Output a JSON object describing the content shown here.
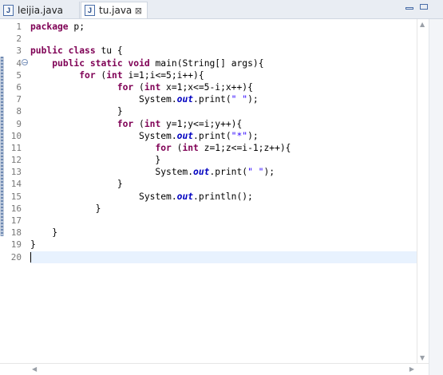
{
  "tabs": [
    {
      "label": "leijia.java",
      "icon": "J",
      "active": false
    },
    {
      "label": "tu.java",
      "icon": "J",
      "active": true,
      "close": "⊠"
    }
  ],
  "window_controls": {
    "minimize": "minimize",
    "maximize": "maximize"
  },
  "editor": {
    "line_numbers": [
      "1",
      "2",
      "3",
      "4",
      "5",
      "6",
      "7",
      "8",
      "9",
      "10",
      "11",
      "12",
      "13",
      "14",
      "15",
      "16",
      "17",
      "18",
      "19",
      "20"
    ],
    "fold_marker_line": "4",
    "current_line": "20",
    "lines": [
      [
        {
          "t": "package",
          "c": "kw"
        },
        {
          "t": " p;",
          "c": ""
        }
      ],
      [],
      [
        {
          "t": "public",
          "c": "kw"
        },
        {
          "t": " ",
          "c": ""
        },
        {
          "t": "class",
          "c": "kw"
        },
        {
          "t": " tu {",
          "c": ""
        }
      ],
      [
        {
          "t": "    ",
          "c": ""
        },
        {
          "t": "public",
          "c": "kw"
        },
        {
          "t": " ",
          "c": ""
        },
        {
          "t": "static",
          "c": "kw"
        },
        {
          "t": " ",
          "c": ""
        },
        {
          "t": "void",
          "c": "kw"
        },
        {
          "t": " main(String[] args){",
          "c": ""
        }
      ],
      [
        {
          "t": "         ",
          "c": ""
        },
        {
          "t": "for",
          "c": "kw"
        },
        {
          "t": " (",
          "c": ""
        },
        {
          "t": "int",
          "c": "kw"
        },
        {
          "t": " i=1;i<=5;i++){",
          "c": ""
        }
      ],
      [
        {
          "t": "                ",
          "c": ""
        },
        {
          "t": "for",
          "c": "kw"
        },
        {
          "t": " (",
          "c": ""
        },
        {
          "t": "int",
          "c": "kw"
        },
        {
          "t": " x=1;x<=5-i;x++){",
          "c": ""
        }
      ],
      [
        {
          "t": "                    System.",
          "c": ""
        },
        {
          "t": "out",
          "c": "fld"
        },
        {
          "t": ".print(",
          "c": ""
        },
        {
          "t": "\" \"",
          "c": "str"
        },
        {
          "t": ");",
          "c": ""
        }
      ],
      [
        {
          "t": "                }",
          "c": ""
        }
      ],
      [
        {
          "t": "                ",
          "c": ""
        },
        {
          "t": "for",
          "c": "kw"
        },
        {
          "t": " (",
          "c": ""
        },
        {
          "t": "int",
          "c": "kw"
        },
        {
          "t": " y=1;y<=i;y++){",
          "c": ""
        }
      ],
      [
        {
          "t": "                    System.",
          "c": ""
        },
        {
          "t": "out",
          "c": "fld"
        },
        {
          "t": ".print(",
          "c": ""
        },
        {
          "t": "\"*\"",
          "c": "str"
        },
        {
          "t": ");",
          "c": ""
        }
      ],
      [
        {
          "t": "                       ",
          "c": ""
        },
        {
          "t": "for",
          "c": "kw"
        },
        {
          "t": " (",
          "c": ""
        },
        {
          "t": "int",
          "c": "kw"
        },
        {
          "t": " z=1;z<=i-1;z++){",
          "c": ""
        }
      ],
      [
        {
          "t": "                       }",
          "c": ""
        }
      ],
      [
        {
          "t": "                       System.",
          "c": ""
        },
        {
          "t": "out",
          "c": "fld"
        },
        {
          "t": ".print(",
          "c": ""
        },
        {
          "t": "\" \"",
          "c": "str"
        },
        {
          "t": ");",
          "c": ""
        }
      ],
      [
        {
          "t": "                }",
          "c": ""
        }
      ],
      [
        {
          "t": "                    System.",
          "c": ""
        },
        {
          "t": "out",
          "c": "fld"
        },
        {
          "t": ".println();",
          "c": ""
        }
      ],
      [
        {
          "t": "            }",
          "c": ""
        }
      ],
      [],
      [
        {
          "t": "    }",
          "c": ""
        }
      ],
      [
        {
          "t": "}",
          "c": ""
        }
      ],
      []
    ]
  }
}
